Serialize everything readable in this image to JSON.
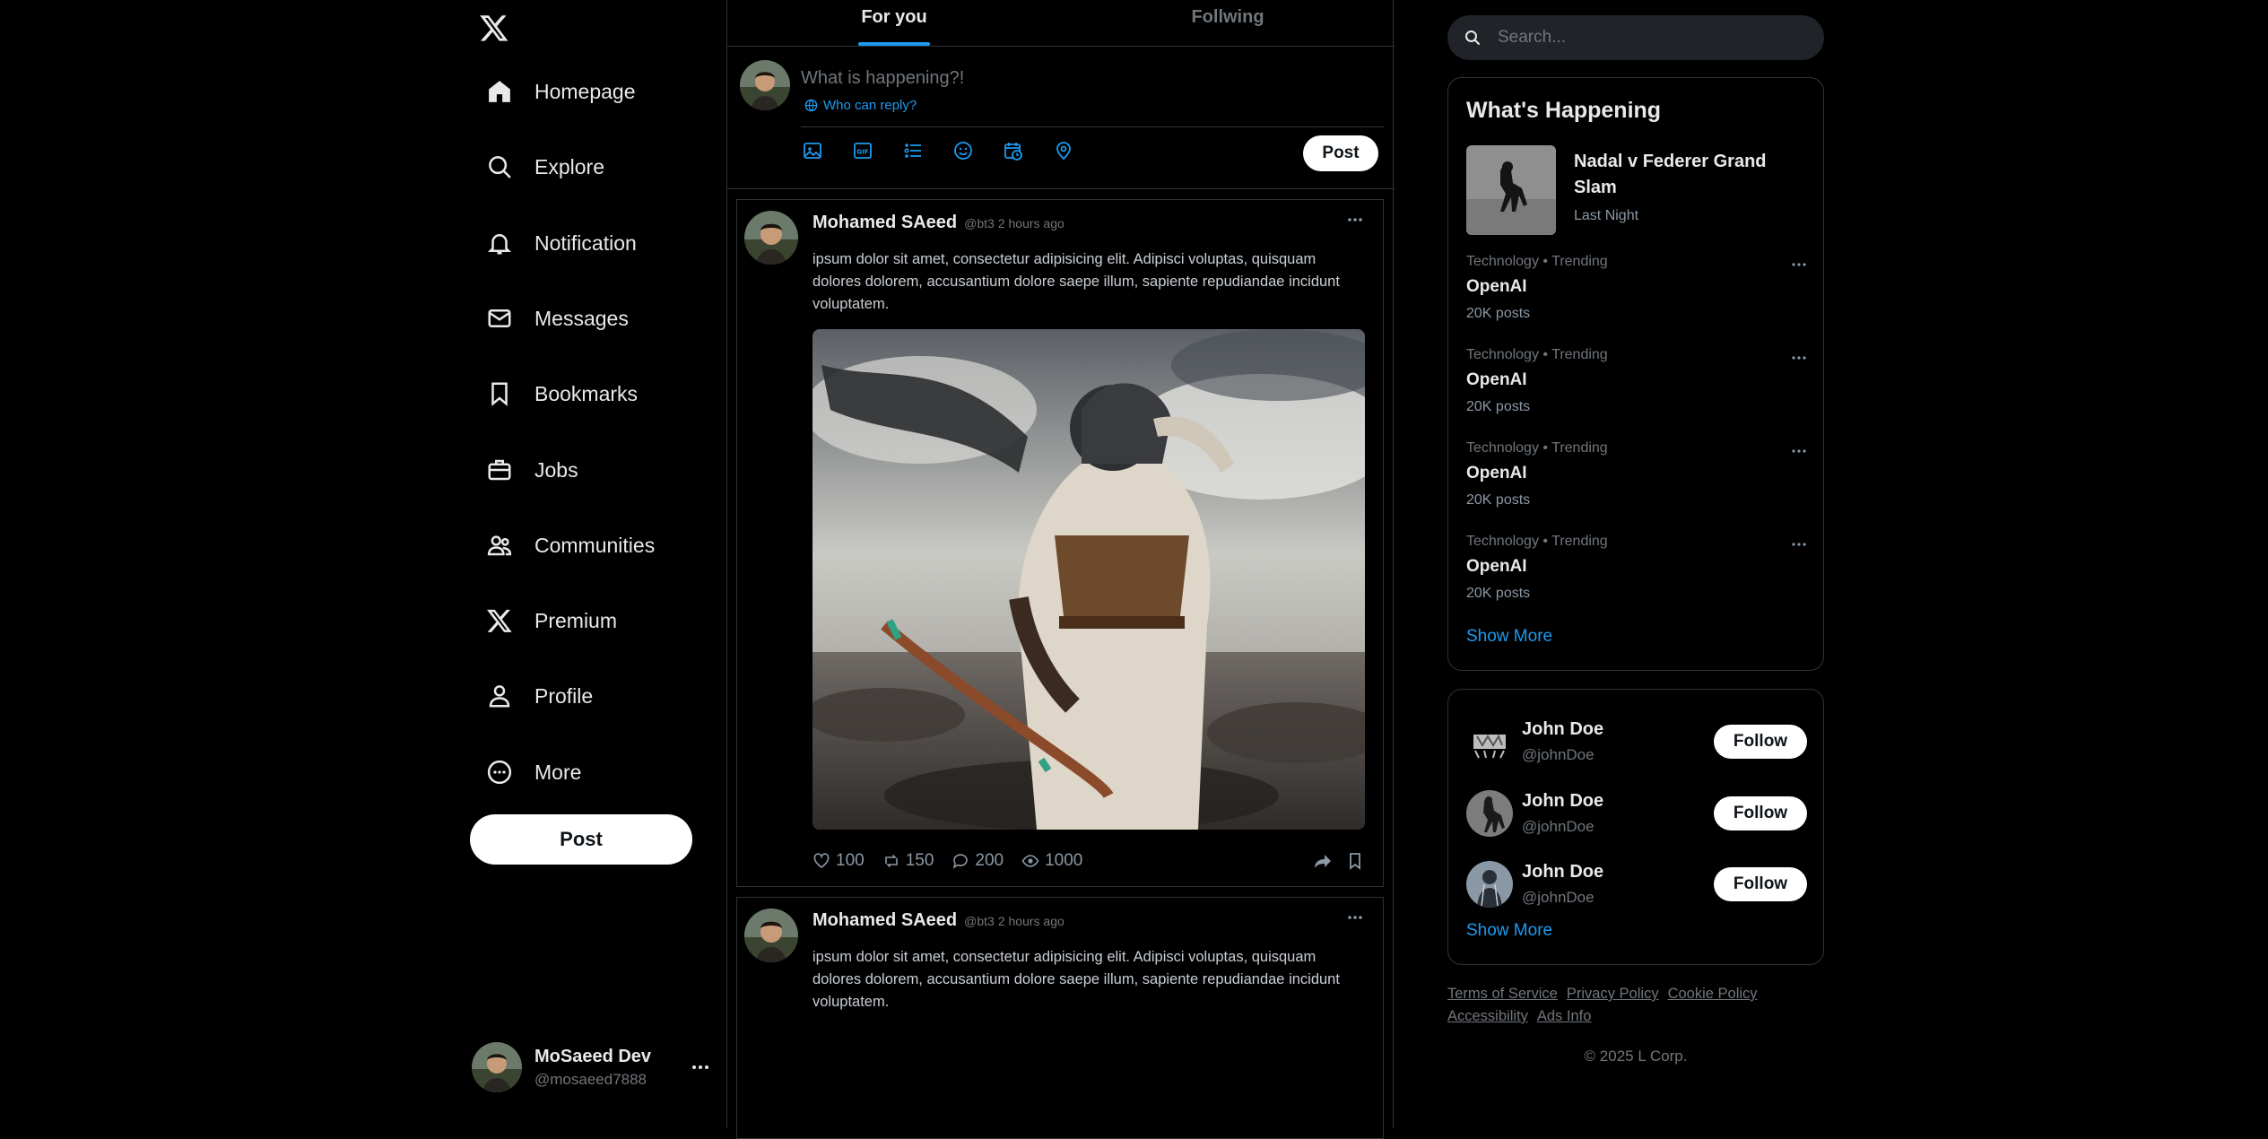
{
  "nav": {
    "items": [
      {
        "label": "Homepage",
        "icon": "home-icon"
      },
      {
        "label": "Explore",
        "icon": "search-icon"
      },
      {
        "label": "Notification",
        "icon": "bell-icon"
      },
      {
        "label": "Messages",
        "icon": "mail-icon"
      },
      {
        "label": "Bookmarks",
        "icon": "bookmark-icon"
      },
      {
        "label": "Jobs",
        "icon": "briefcase-icon"
      },
      {
        "label": "Communities",
        "icon": "people-icon"
      },
      {
        "label": "Premium",
        "icon": "x-logo-icon"
      },
      {
        "label": "Profile",
        "icon": "person-icon"
      },
      {
        "label": "More",
        "icon": "more-circle-icon"
      }
    ],
    "post_label": "Post"
  },
  "account": {
    "name": "MoSaeed Dev",
    "handle": "@mosaeed7888"
  },
  "tabs": [
    {
      "label": "For you",
      "active": true
    },
    {
      "label": "Follwing",
      "active": false
    }
  ],
  "composer": {
    "placeholder": "What is happening?!",
    "who_can_reply": "Who can reply?",
    "post_label": "Post"
  },
  "tweets": [
    {
      "name": "Mohamed SAeed",
      "handle": "@bt3",
      "time": "2 hours ago",
      "text": "ipsum dolor sit amet, consectetur adipisicing elit. Adipisci voluptas, quisquam dolores dolorem, accusantium dolore saepe illum, sapiente repudiandae incidunt voluptatem.",
      "likes": "100",
      "retweets": "150",
      "replies": "200",
      "views": "1000"
    },
    {
      "name": "Mohamed SAeed",
      "handle": "@bt3",
      "time": "2 hours ago",
      "text": "ipsum dolor sit amet, consectetur adipisicing elit. Adipisci voluptas, quisquam dolores dolorem, accusantium dolore saepe illum, sapiente repudiandae incidunt voluptatem."
    }
  ],
  "search": {
    "placeholder": "Search..."
  },
  "happening": {
    "title": "What's Happening",
    "featured": {
      "title": "Nadal v Federer Grand Slam",
      "subtitle": "Last Night"
    },
    "trends": [
      {
        "category": "Technology • Trending",
        "name": "OpenAI",
        "count": "20K posts"
      },
      {
        "category": "Technology • Trending",
        "name": "OpenAI",
        "count": "20K posts"
      },
      {
        "category": "Technology • Trending",
        "name": "OpenAI",
        "count": "20K posts"
      },
      {
        "category": "Technology • Trending",
        "name": "OpenAI",
        "count": "20K posts"
      }
    ],
    "show_more": "Show More"
  },
  "who_to_follow": {
    "users": [
      {
        "name": "John Doe",
        "handle": "@johnDoe",
        "button": "Follow"
      },
      {
        "name": "John Doe",
        "handle": "@johnDoe",
        "button": "Follow"
      },
      {
        "name": "John Doe",
        "handle": "@johnDoe",
        "button": "Follow"
      }
    ],
    "show_more": "Show More"
  },
  "footer": {
    "links": [
      "Terms of Service",
      "Privacy Policy",
      "Cookie Policy",
      "Accessibility",
      "Ads Info"
    ],
    "copyright": "© 2025 L Corp."
  },
  "colors": {
    "accent": "#1d9bf0",
    "background": "#000000",
    "border": "#2f3336",
    "muted": "#71767b"
  }
}
